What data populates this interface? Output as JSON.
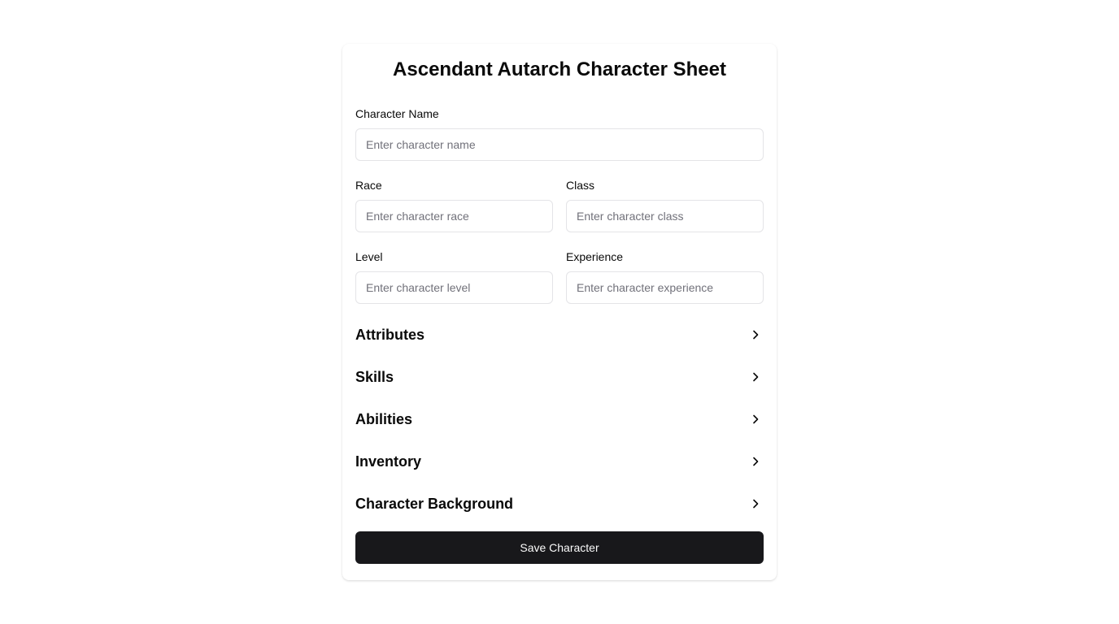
{
  "header": {
    "title": "Ascendant Autarch Character Sheet"
  },
  "fields": {
    "name": {
      "label": "Character Name",
      "placeholder": "Enter character name",
      "value": ""
    },
    "race": {
      "label": "Race",
      "placeholder": "Enter character race",
      "value": ""
    },
    "class": {
      "label": "Class",
      "placeholder": "Enter character class",
      "value": ""
    },
    "level": {
      "label": "Level",
      "placeholder": "Enter character level",
      "value": ""
    },
    "experience": {
      "label": "Experience",
      "placeholder": "Enter character experience",
      "value": ""
    }
  },
  "sections": [
    {
      "label": "Attributes",
      "icon": "chevron-right-icon"
    },
    {
      "label": "Skills",
      "icon": "chevron-right-icon"
    },
    {
      "label": "Abilities",
      "icon": "chevron-right-icon"
    },
    {
      "label": "Inventory",
      "icon": "chevron-right-icon"
    },
    {
      "label": "Character Background",
      "icon": "chevron-right-icon"
    }
  ],
  "actions": {
    "save_label": "Save Character"
  },
  "colors": {
    "primary_button": "#18181b",
    "input_border": "#e4e4e7",
    "placeholder": "#71717a"
  }
}
